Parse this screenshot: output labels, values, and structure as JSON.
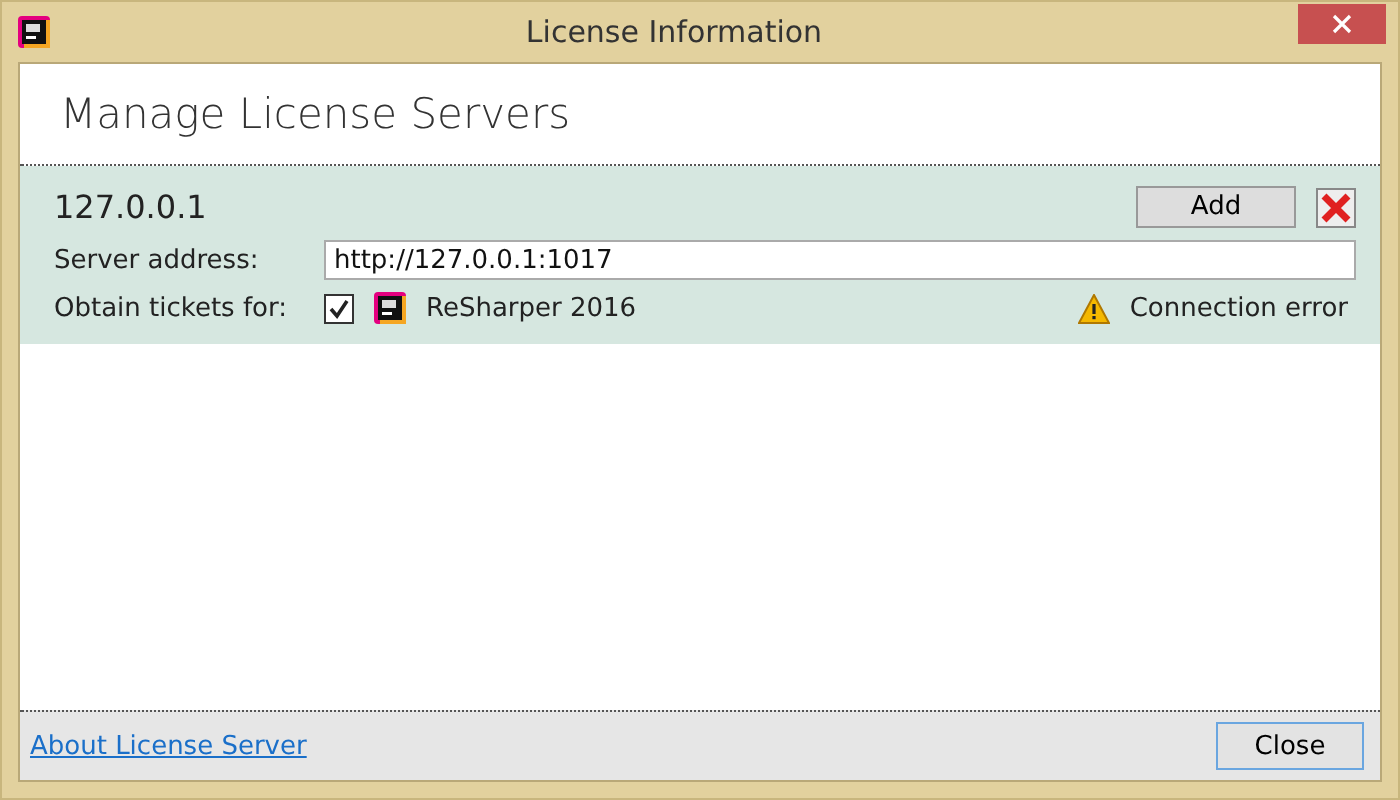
{
  "window": {
    "title": "License Information"
  },
  "header": {
    "title": "Manage License Servers"
  },
  "servers": [
    {
      "name": "127.0.0.1",
      "add_label": "Add",
      "address_label": "Server address:",
      "address": "http://127.0.0.1:1017",
      "tickets_label": "Obtain tickets for:",
      "products": [
        {
          "name": "ReSharper 2016",
          "checked": true
        }
      ],
      "status": "Connection error"
    }
  ],
  "footer": {
    "link": "About License Server",
    "close": "Close"
  }
}
